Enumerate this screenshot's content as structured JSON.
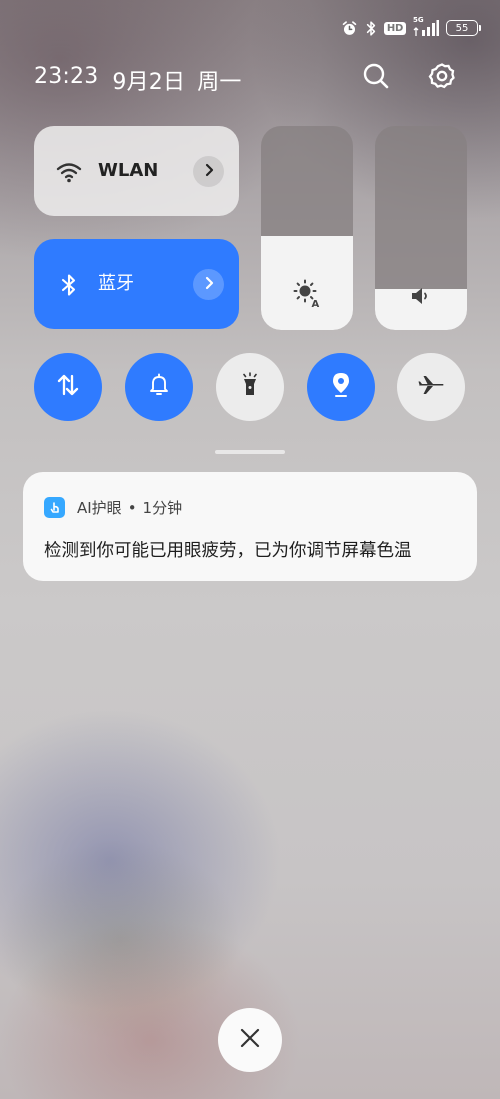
{
  "status_bar": {
    "icons": [
      "alarm-icon",
      "bluetooth-icon",
      "hd-icon",
      "signal-5g-icon",
      "battery-icon"
    ],
    "hd_label": "HD",
    "network_label": "5G",
    "battery_level": "55"
  },
  "header": {
    "time": "23:23",
    "date": "9月2日",
    "weekday": "周一",
    "actions": [
      "search-icon",
      "settings-gear-icon"
    ]
  },
  "quick_tiles": {
    "wlan": {
      "label": "WLAN",
      "icon": "wifi-icon",
      "state": "off"
    },
    "bluetooth": {
      "label": "蓝牙",
      "icon": "bluetooth-icon",
      "state": "on"
    }
  },
  "sliders": {
    "brightness": {
      "icon": "auto-brightness-icon",
      "level": 0.46
    },
    "volume": {
      "icon": "volume-icon",
      "level": 0.2
    }
  },
  "toggles": [
    {
      "name": "mobile-data",
      "icon": "data-transfer-icon",
      "state": "on"
    },
    {
      "name": "ring",
      "icon": "bell-icon",
      "state": "on"
    },
    {
      "name": "flashlight",
      "icon": "flashlight-icon",
      "state": "off"
    },
    {
      "name": "location",
      "icon": "location-pin-icon",
      "state": "on"
    },
    {
      "name": "airplane-mode",
      "icon": "airplane-icon",
      "state": "off"
    }
  ],
  "notification": {
    "app_name": "AI护眼",
    "separator": "•",
    "time": "1分钟",
    "message": "检测到你可能已用眼疲劳，已为你调节屏幕色温"
  },
  "colors": {
    "accent": "#2f7bff",
    "tile_off": "#ececec",
    "app_icon": "#36a8ff"
  }
}
